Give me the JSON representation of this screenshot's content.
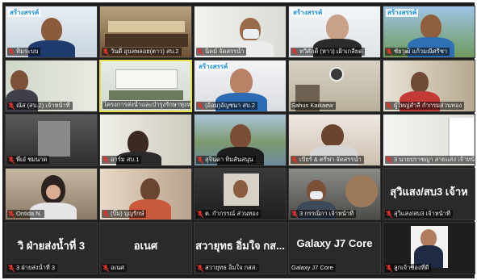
{
  "participants": [
    {
      "name": "ทิมระบบ",
      "logo": "สร้างสรรค์"
    },
    {
      "name": "วันดี อุบลพลอย(ตาว) สบ.2"
    },
    {
      "name": "นิคม์ จัดสรรน้ำ"
    },
    {
      "name": "ทวีศักดิ์ (หาว) เฝ้าเกลียด",
      "logo": "สร้างสรรค์"
    },
    {
      "name": "ชัยวุฒิ แก้วมณีศรีชา",
      "logo": "สร้างสรรค์"
    },
    {
      "name": "ณัส (สบ.2) เจ้าหน้าที่"
    },
    {
      "name": "โครงการส่งน้ำและบำรุงรักษาทุ่งหลวง"
    },
    {
      "name": "(อ้อม)อัญชนา สบ.2",
      "logo": "สร้างสรรค์"
    },
    {
      "name": "Sahus Kaikaew"
    },
    {
      "name": "ผู้ใหญ่สำลี กำกรมส่วนทอง"
    },
    {
      "name": "พี่เอ๋ ชมนาด"
    },
    {
      "name": "อาร์ม สบ.1"
    },
    {
      "name": "สุจินดา ทิมสันสนุน"
    },
    {
      "name": "เบียร์ & ตรีฟา จัดสรรน้ำ"
    },
    {
      "name": "3 นายปราชญา สายแสง เจ้าหน้าที่"
    },
    {
      "name": "Ontida N."
    },
    {
      "name": "(บิ๊ม) บุญรักษ์"
    },
    {
      "name": "ต. กำกรรณ์ ส่วนทอง"
    },
    {
      "name": "3 กรรณิกา เจ้าหน้าที่"
    },
    {
      "name": "สุวิแสง/สบ3 เจ้าหน้าที่",
      "big": "สุวิแสง/สบ3 เจ้าห"
    },
    {
      "name": "3 ฝ่ายส่งน้ำที่ 3",
      "big": "วิ ฝ่ายส่งน้ำที่ 3"
    },
    {
      "name": "อเนศ",
      "big": "อเนศ"
    },
    {
      "name": "สวายุทธ อิ่มใจ กสส.",
      "big": "สวายุทธ อิ่มใจ กส..."
    },
    {
      "name": "Galaxy J7 Core",
      "big": "Galaxy J7 Core"
    },
    {
      "name": "ลูกเจ้าของที่ดี"
    }
  ],
  "colors": {
    "mic_muted": "#e0332d",
    "active_speaker": "#e8e34a",
    "logo_blue": "#1d8fd6"
  }
}
